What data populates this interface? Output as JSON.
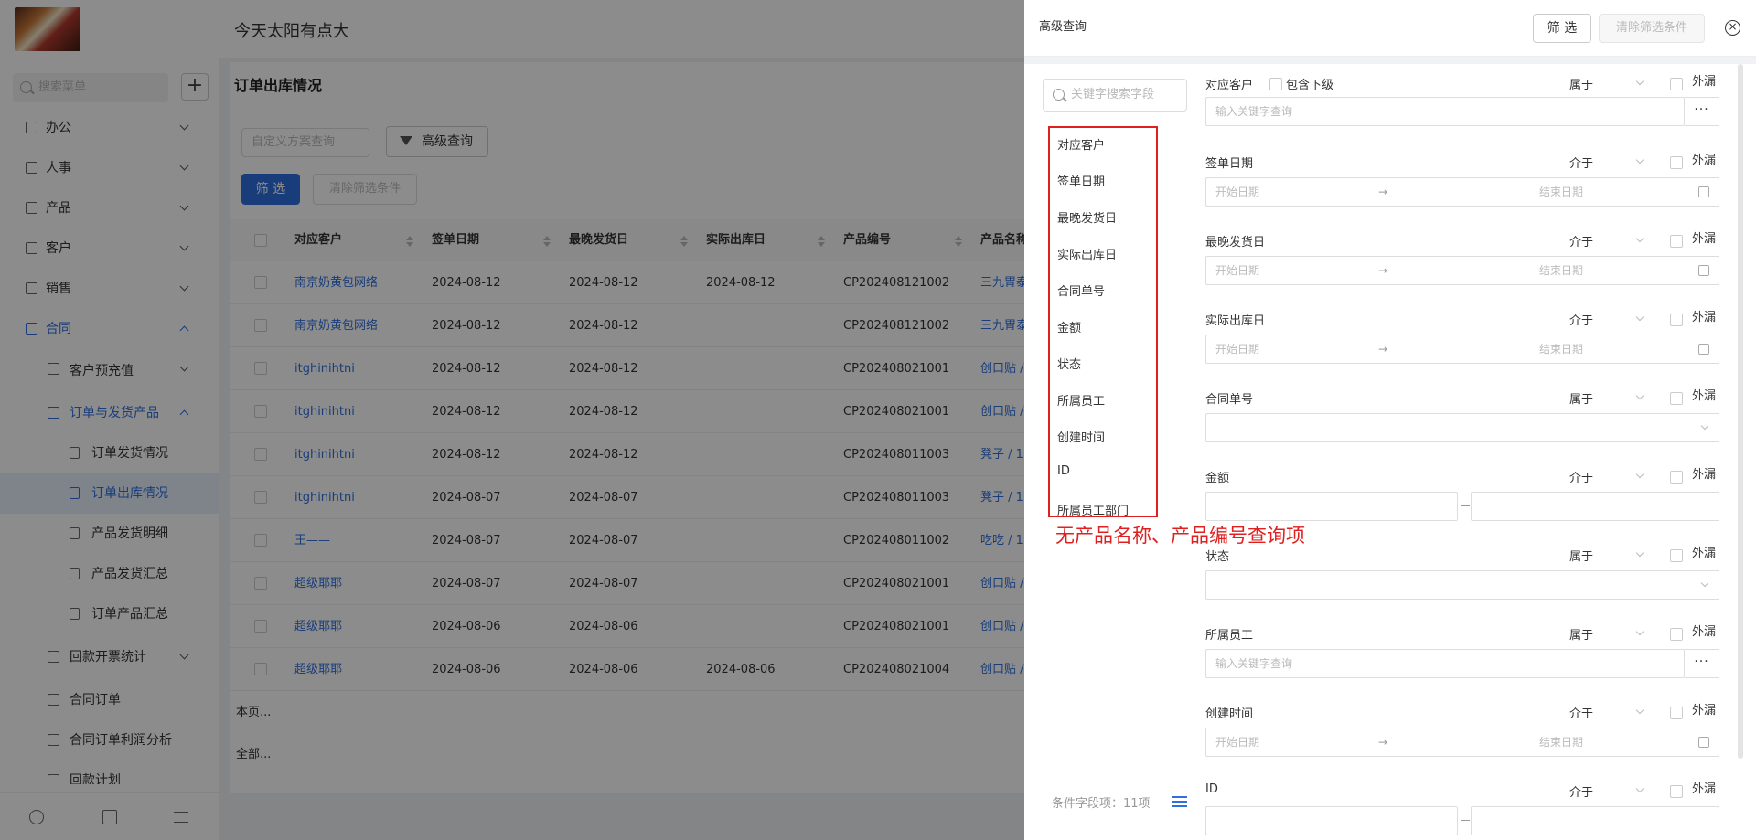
{
  "app": {
    "title": "今天太阳有点大"
  },
  "sidebar": {
    "search_placeholder": "搜索菜单",
    "add_label": "+",
    "items": [
      {
        "label": "办公",
        "icon": "office-icon"
      },
      {
        "label": "人事",
        "icon": "people-icon"
      },
      {
        "label": "产品",
        "icon": "box-icon"
      },
      {
        "label": "客户",
        "icon": "customer-icon"
      },
      {
        "label": "销售",
        "icon": "sales-icon"
      },
      {
        "label": "合同",
        "icon": "contract-icon"
      },
      {
        "label": "客户预充值",
        "icon": "copy-icon"
      },
      {
        "label": "订单与发货产品",
        "icon": "copy-icon"
      },
      {
        "label": "订单发货情况",
        "icon": "doc-icon"
      },
      {
        "label": "订单出库情况",
        "icon": "doc-icon"
      },
      {
        "label": "产品发货明细",
        "icon": "doc-icon"
      },
      {
        "label": "产品发货汇总",
        "icon": "calc-icon"
      },
      {
        "label": "订单产品汇总",
        "icon": "calc-icon"
      },
      {
        "label": "回款开票统计",
        "icon": "copy-icon"
      },
      {
        "label": "合同订单",
        "icon": "doc-icon"
      },
      {
        "label": "合同订单利润分析",
        "icon": "doc-icon"
      },
      {
        "label": "回款计划",
        "icon": "doc-icon"
      }
    ],
    "footer_icons": [
      "history-icon",
      "settings-icon",
      "collapse-icon"
    ]
  },
  "main": {
    "page_title": "订单出库情况",
    "plan_placeholder": "自定义方案查询",
    "advanced_label": "高级查询",
    "filter_label": "筛 选",
    "clear_label": "清除筛选条件",
    "columns": [
      "对应客户",
      "签单日期",
      "最晚发货日",
      "实际出库日",
      "产品编号",
      "产品名称"
    ],
    "rows": [
      [
        "南京奶黄包网络",
        "2024-08-12",
        "2024-08-12",
        "2024-08-12",
        "CP202408121002",
        "三九胃泰"
      ],
      [
        "南京奶黄包网络",
        "2024-08-12",
        "2024-08-12",
        "",
        "CP202408121002",
        "三九胃泰"
      ],
      [
        "itghinihtni",
        "2024-08-12",
        "2024-08-12",
        "",
        "CP202408021001",
        "创口贴 /"
      ],
      [
        "itghinihtni",
        "2024-08-12",
        "2024-08-12",
        "",
        "CP202408021001",
        "创口贴 /"
      ],
      [
        "itghinihtni",
        "2024-08-12",
        "2024-08-12",
        "",
        "CP202408011003",
        "凳子 / 1"
      ],
      [
        "itghinihtni",
        "2024-08-07",
        "2024-08-07",
        "",
        "CP202408011003",
        "凳子 / 1"
      ],
      [
        "王——",
        "2024-08-07",
        "2024-08-07",
        "",
        "CP202408011002",
        "吃吃 / 1"
      ],
      [
        "超级耶耶",
        "2024-08-07",
        "2024-08-07",
        "",
        "CP202408021001",
        "创口贴 /"
      ],
      [
        "超级耶耶",
        "2024-08-06",
        "2024-08-06",
        "",
        "CP202408021001",
        "创口贴 /"
      ],
      [
        "超级耶耶",
        "2024-08-06",
        "2024-08-06",
        "2024-08-06",
        "CP202408021004",
        "创口贴 /"
      ]
    ],
    "summary_page": "本页...",
    "summary_all": "全部..."
  },
  "drawer": {
    "title": "高级查询",
    "filter_label": "筛 选",
    "clear_label": "清除筛选条件",
    "close_label": "×",
    "keyword_placeholder": "关键字搜索字段",
    "field_list": [
      "对应客户",
      "签单日期",
      "最晚发货日",
      "实际出库日",
      "合同单号",
      "金额",
      "状态",
      "所属员工",
      "创建时间",
      "ID",
      "所属员工部门"
    ],
    "annotation": "无产品名称、产品编号查询项",
    "condition_count": "条件字段项：11项",
    "include_sub_label": "包含下级",
    "exclude_label": "外漏",
    "keyword_input_placeholder": "输入关键字查询",
    "start_date": "开始日期",
    "end_date": "结束日期",
    "arrow": "→",
    "more": "···",
    "conditions": [
      {
        "label": "对应客户",
        "op": "属于"
      },
      {
        "label": "签单日期",
        "op": "介于"
      },
      {
        "label": "最晚发货日",
        "op": "介于"
      },
      {
        "label": "实际出库日",
        "op": "介于"
      },
      {
        "label": "合同单号",
        "op": "属于"
      },
      {
        "label": "金额",
        "op": "介于"
      },
      {
        "label": "状态",
        "op": "属于"
      },
      {
        "label": "所属员工",
        "op": "属于"
      },
      {
        "label": "创建时间",
        "op": "介于"
      },
      {
        "label": "ID",
        "op": "介于"
      }
    ]
  }
}
